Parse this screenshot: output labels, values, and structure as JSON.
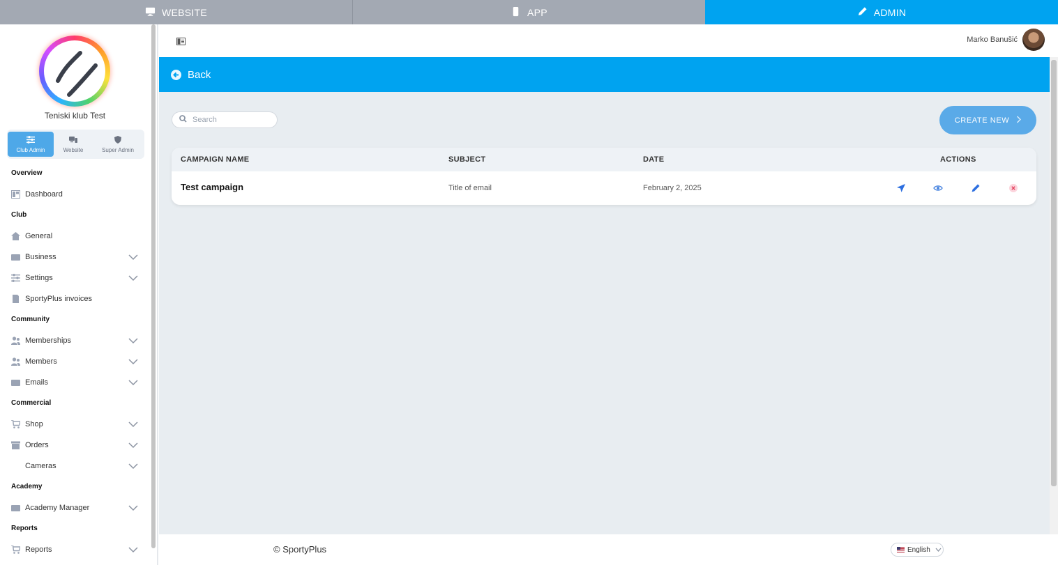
{
  "topbar": {
    "modes": [
      {
        "label": "WEBSITE",
        "icon": "monitor-icon"
      },
      {
        "label": "APP",
        "icon": "phone-icon"
      },
      {
        "label": "ADMIN",
        "icon": "pencil-icon",
        "active": true
      }
    ],
    "active_color": "#00a3f0",
    "inactive_color": "#a3a9b3"
  },
  "sidebar": {
    "club_name": "Teniski klub Test",
    "role_tabs": [
      {
        "label": "Club Admin",
        "icon": "sliders-icon",
        "active": true
      },
      {
        "label": "Website",
        "icon": "devices-icon"
      },
      {
        "label": "Super Admin",
        "icon": "shield-icon"
      }
    ],
    "sections": {
      "overview": "Overview",
      "club": "Club",
      "community": "Community",
      "commercial": "Commercial",
      "academy": "Academy",
      "reports": "Reports"
    },
    "items": {
      "dashboard": "Dashboard",
      "general": "General",
      "business": "Business",
      "settings": "Settings",
      "invoices": "SportyPlus invoices",
      "memberships": "Memberships",
      "members": "Members",
      "emails": "Emails",
      "shop": "Shop",
      "orders": "Orders",
      "cameras": "Cameras",
      "academy_manager": "Academy Manager",
      "reports": "Reports"
    }
  },
  "header": {
    "user_name": "Marko Banušić"
  },
  "back_bar": {
    "label": "Back",
    "color": "#00a3f0"
  },
  "toolbar": {
    "search_placeholder": "Search",
    "search_value": "",
    "create_label": "CREATE NEW"
  },
  "table": {
    "columns": [
      "CAMPAIGN NAME",
      "SUBJECT",
      "DATE",
      "ACTIONS"
    ],
    "rows": [
      {
        "name": "Test campaign",
        "subject": "Title of email",
        "date": "February 2, 2025",
        "actions": [
          "send-icon",
          "eye-icon",
          "edit-icon",
          "delete-icon"
        ]
      }
    ]
  },
  "footer": {
    "copyright": "© SportyPlus",
    "language": "English"
  }
}
